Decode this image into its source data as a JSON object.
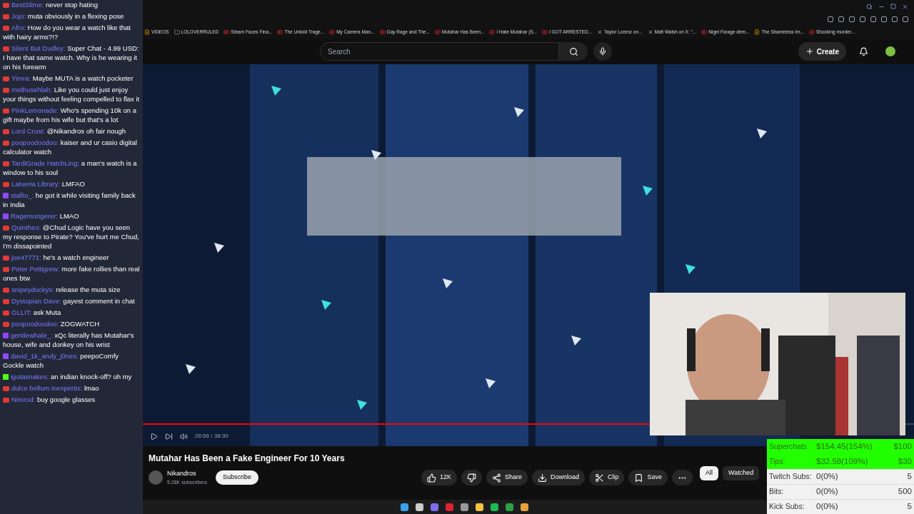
{
  "chat": [
    {
      "kind": "youtube",
      "name": "BestSlime:",
      "text": "never stop hating"
    },
    {
      "kind": "youtube",
      "name": "Jojo:",
      "text": "muta obviously in a flexing pose"
    },
    {
      "kind": "youtube",
      "name": "Afro:",
      "text": "How do you wear a watch like that with hairy arms?!?"
    },
    {
      "kind": "youtube",
      "name": "Silent But Dudley:",
      "text": "Super Chat - 4.99 USD: I have that same watch. Why is he wearing it on his forearm"
    },
    {
      "kind": "youtube",
      "name": "Yimra:",
      "text": "Maybe MUTA is a watch pocketer"
    },
    {
      "kind": "youtube",
      "name": "methusehlah:",
      "text": "Like you could just enjoy your things without feeling compelled to flax it"
    },
    {
      "kind": "youtube",
      "name": "PinkLemonade:",
      "text": "Who's spending 10k on a gift maybe from his wife but that's a lot"
    },
    {
      "kind": "youtube",
      "name": "Lord Crust:",
      "text": "@Nikandros oh fair nough"
    },
    {
      "kind": "youtube",
      "name": "poopoodoodoo:",
      "text": "kaiser and ur casio digital calculator watch"
    },
    {
      "kind": "youtube",
      "name": "TardiGrade HatchLing:",
      "text": "a man's watch is a window to his soul"
    },
    {
      "kind": "youtube",
      "name": "Latveria Library:",
      "text": "LMFAO"
    },
    {
      "kind": "twitch",
      "name": "stallio_:",
      "text": "he got it while visiting family back in India"
    },
    {
      "kind": "twitch",
      "name": "Ragemongerer:",
      "text": "LMAO"
    },
    {
      "kind": "youtube",
      "name": "Quintheo:",
      "text": "@Chud Logic have you seen my response to Pirate? You've hurt me Chud, I'm dissapointed"
    },
    {
      "kind": "youtube",
      "name": "joe47771:",
      "text": "he's a watch engineer"
    },
    {
      "kind": "youtube",
      "name": "Peter Pettigrew:",
      "text": "more fake rollies than real ones btw"
    },
    {
      "kind": "youtube",
      "name": "snipeyduckys:",
      "text": "release the muta size"
    },
    {
      "kind": "youtube",
      "name": "Dystopian Dave:",
      "text": "gayest comment in chat"
    },
    {
      "kind": "youtube",
      "name": "GLLIT:",
      "text": "ask Muta"
    },
    {
      "kind": "youtube",
      "name": "poopoodoodoo:",
      "text": "ZOGWATCH"
    },
    {
      "kind": "twitch",
      "name": "gentlewhale_:",
      "text": "xQc literally has Mutahar's house, wife and donkey on his wrist"
    },
    {
      "kind": "twitch",
      "name": "david_1k_andy_j0nes:",
      "text": "peepoComfy Gockle watch"
    },
    {
      "kind": "kick",
      "name": "igotasnakes:",
      "text": "an indian knock-off? oh my"
    },
    {
      "kind": "youtube",
      "name": "dulce bellum inexpertis:",
      "text": "lmao"
    },
    {
      "kind": "youtube",
      "name": "Nimrod:",
      "text": "buy google glasses"
    }
  ],
  "bookmarks": [
    {
      "kind": "page",
      "label": "VIDEOS"
    },
    {
      "kind": "folder",
      "label": "LOLOVERRULED"
    },
    {
      "kind": "youtube",
      "label": "Steam Faces Fina..."
    },
    {
      "kind": "youtube",
      "label": "The Untold Trage..."
    },
    {
      "kind": "youtube",
      "label": "My Camera Man..."
    },
    {
      "kind": "youtube",
      "label": "Gay Rage and The..."
    },
    {
      "kind": "youtube",
      "label": "Mutahar Has Been..."
    },
    {
      "kind": "youtube",
      "label": "I Hate Mutahar (S..."
    },
    {
      "kind": "youtube",
      "label": "I GOT ARRESTED..."
    },
    {
      "kind": "x",
      "label": "Taylor Lorenz on..."
    },
    {
      "kind": "x",
      "label": "Matt Walsh on X: \"..."
    },
    {
      "kind": "youtube",
      "label": "Nigel Farage dem..."
    },
    {
      "kind": "page",
      "label": "The Shameless Im..."
    },
    {
      "kind": "youtube",
      "label": "Shocking murder..."
    }
  ],
  "search": {
    "placeholder": "Search"
  },
  "create_button": "Create",
  "player": {
    "time": "26:56 / 38:30",
    "level": 0.7
  },
  "video": {
    "title": "Mutahar Has Been a Fake Engineer For 10 Years",
    "channel": "Nikandros",
    "subscribers": "5.28K subscribers",
    "subscribe": "Subscribe"
  },
  "actions": [
    {
      "kind": "like",
      "label": "12K"
    },
    {
      "kind": "dislike"
    },
    {
      "kind": "share",
      "label": "Share"
    },
    {
      "kind": "download",
      "label": "Download"
    },
    {
      "kind": "clip",
      "label": "Clip"
    },
    {
      "kind": "save",
      "label": "Save"
    },
    {
      "kind": "more"
    }
  ],
  "chips": [
    {
      "label": "All",
      "selected": true
    },
    {
      "label": "Watched",
      "selected": false
    }
  ],
  "goals": [
    {
      "label": "Superchats",
      "value": "$154.45(154%)",
      "goal": "$100",
      "reached": true
    },
    {
      "label": "Tips:",
      "value": "$32.58(109%)",
      "goal": "$30",
      "reached": true
    },
    {
      "label": "Twitch Subs:",
      "value": "0(0%)",
      "goal": "5",
      "reached": false
    },
    {
      "label": "Bits:",
      "value": "0(0%)",
      "goal": "500",
      "reached": false
    },
    {
      "label": "Kick Subs:",
      "value": "0(0%)",
      "goal": "5",
      "reached": false
    }
  ]
}
